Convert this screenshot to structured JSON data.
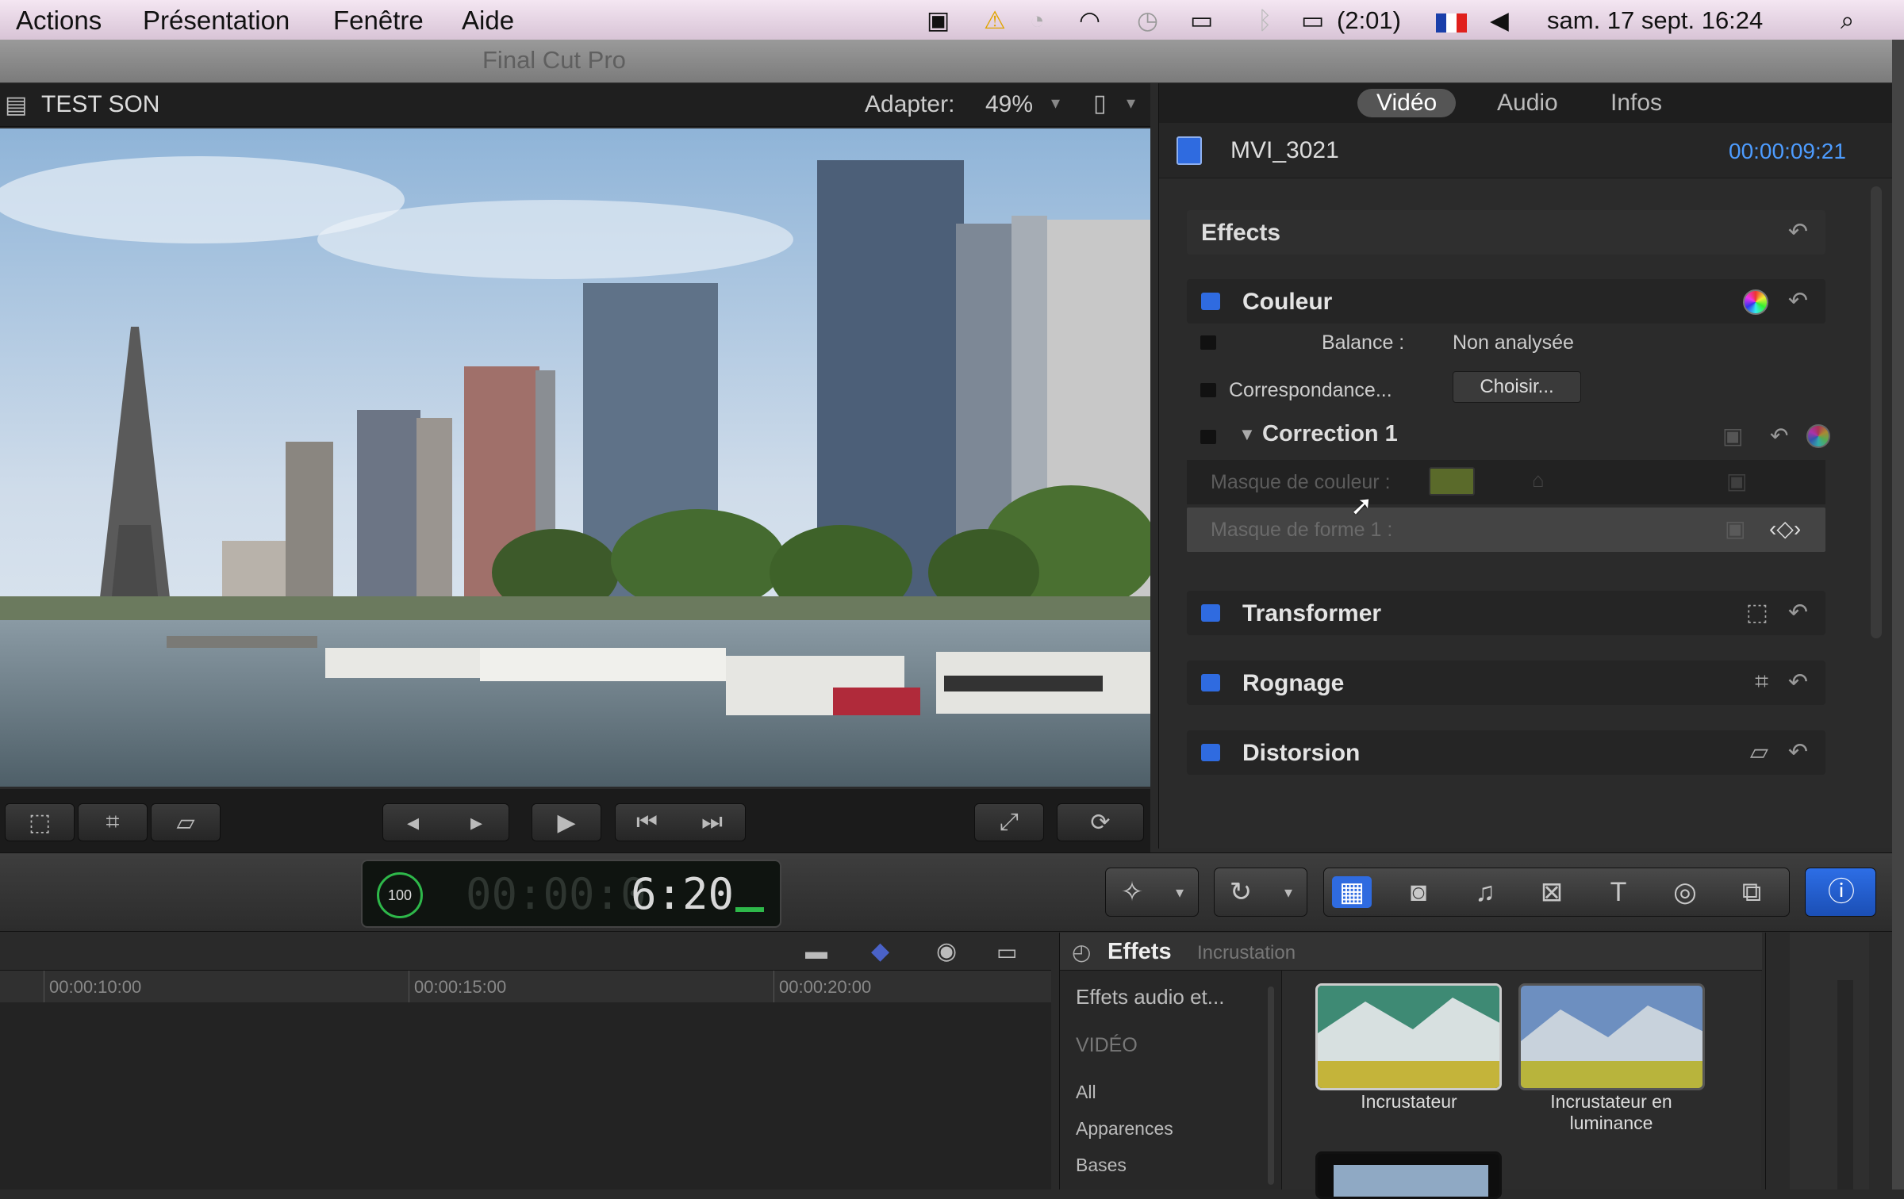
{
  "menubar": {
    "menus": [
      "Actions",
      "Présentation",
      "Fenêtre",
      "Aide"
    ],
    "battery": "(2:01)",
    "datetime": "sam. 17 sept.  16:24"
  },
  "window": {
    "title": "Final Cut Pro"
  },
  "viewer": {
    "project_name": "TEST SON",
    "zoom_label": "Adapter:",
    "zoom_value": "49%"
  },
  "inspector": {
    "tabs": [
      "Vidéo",
      "Audio",
      "Infos"
    ],
    "active_tab": "Vidéo",
    "clip_name": "MVI_3021",
    "clip_duration": "00:00:09:21",
    "effects_header": "Effects",
    "couleur": {
      "title": "Couleur",
      "balance_label": "Balance :",
      "balance_value": "Non analysée",
      "match_label": "Correspondance...",
      "match_button": "Choisir...",
      "correction_title": "Correction 1",
      "color_mask_label": "Masque de couleur :",
      "shape_mask_label": "Masque de forme 1 :"
    },
    "sections": [
      "Transformer",
      "Rognage",
      "Distorsion"
    ]
  },
  "timecode": {
    "value": "6:20",
    "zoom": "100"
  },
  "timeline": {
    "ticks": [
      "00:00:10:00",
      "00:00:15:00",
      "00:00:20:00"
    ]
  },
  "effects_browser": {
    "title": "Effets",
    "subtitle": "Incrustation",
    "categories_header": "Effets audio et...",
    "section": "VIDÉO",
    "categories": [
      "All",
      "Apparences",
      "Bases"
    ],
    "items": [
      "Incrustateur",
      "Incrustateur en luminance"
    ]
  },
  "colors": {
    "accent_blue": "#2f6be0",
    "timecode_blue": "#4d9cff"
  }
}
